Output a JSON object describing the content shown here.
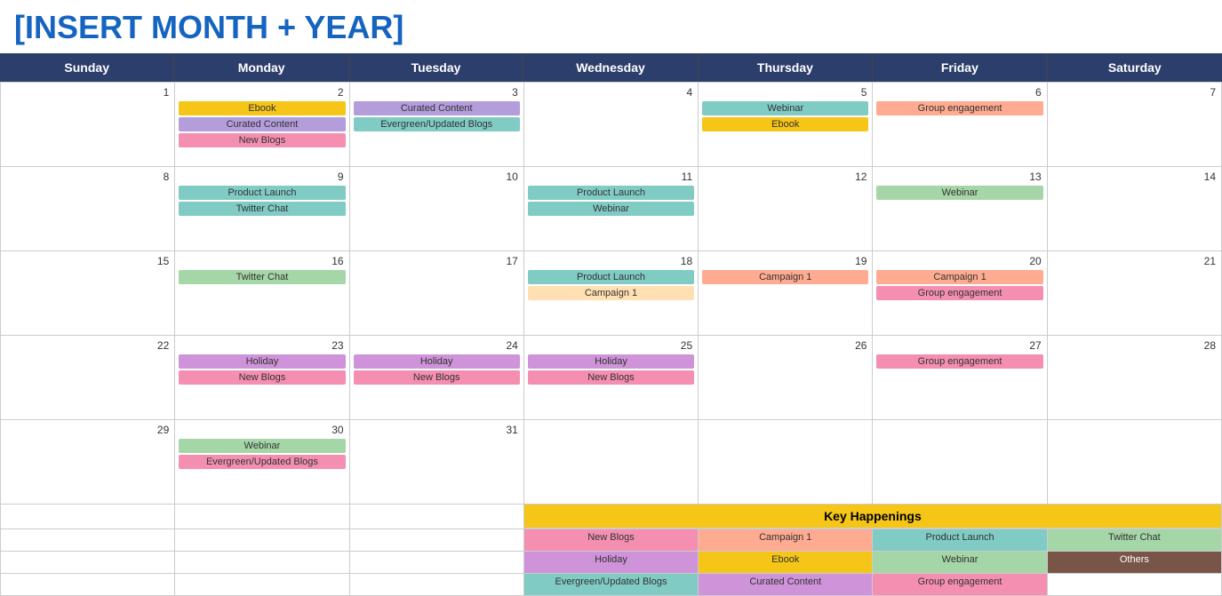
{
  "title": "[INSERT MONTH + YEAR]",
  "days": [
    "Sunday",
    "Monday",
    "Tuesday",
    "Wednesday",
    "Thursday",
    "Friday",
    "Saturday"
  ],
  "weeks": [
    {
      "cells": [
        {
          "date": "1",
          "events": []
        },
        {
          "date": "2",
          "events": [
            {
              "label": "Ebook",
              "color": "ev-yellow"
            },
            {
              "label": "Curated Content",
              "color": "ev-purple"
            },
            {
              "label": "New Blogs",
              "color": "ev-pink"
            }
          ]
        },
        {
          "date": "3",
          "events": [
            {
              "label": "Curated Content",
              "color": "ev-purple"
            },
            {
              "label": "Evergreen/Updated Blogs",
              "color": "ev-teal"
            }
          ]
        },
        {
          "date": "4",
          "events": []
        },
        {
          "date": "5",
          "events": [
            {
              "label": "Webinar",
              "color": "ev-teal"
            },
            {
              "label": "Ebook",
              "color": "ev-yellow"
            }
          ]
        },
        {
          "date": "6",
          "events": [
            {
              "label": "Group engagement",
              "color": "ev-salmon"
            }
          ]
        },
        {
          "date": "7",
          "events": []
        }
      ]
    },
    {
      "cells": [
        {
          "date": "8",
          "events": []
        },
        {
          "date": "9",
          "events": [
            {
              "label": "Product Launch",
              "color": "ev-teal"
            },
            {
              "label": "Twitter Chat",
              "color": "ev-teal"
            }
          ]
        },
        {
          "date": "10",
          "events": []
        },
        {
          "date": "11",
          "events": [
            {
              "label": "Product Launch",
              "color": "ev-teal"
            },
            {
              "label": "Webinar",
              "color": "ev-teal"
            }
          ]
        },
        {
          "date": "12",
          "events": []
        },
        {
          "date": "13",
          "events": [
            {
              "label": "Webinar",
              "color": "ev-green"
            }
          ]
        },
        {
          "date": "14",
          "events": []
        }
      ]
    },
    {
      "cells": [
        {
          "date": "15",
          "events": []
        },
        {
          "date": "16",
          "events": [
            {
              "label": "Twitter Chat",
              "color": "ev-green"
            }
          ]
        },
        {
          "date": "17",
          "events": []
        },
        {
          "date": "18",
          "events": [
            {
              "label": "Product Launch",
              "color": "ev-teal"
            },
            {
              "label": "Campaign 1",
              "color": "ev-peach"
            }
          ]
        },
        {
          "date": "19",
          "events": [
            {
              "label": "Campaign 1",
              "color": "ev-salmon"
            }
          ]
        },
        {
          "date": "20",
          "events": [
            {
              "label": "Campaign 1",
              "color": "ev-salmon"
            },
            {
              "label": "Group engagement",
              "color": "ev-pink"
            }
          ]
        },
        {
          "date": "21",
          "events": []
        }
      ]
    },
    {
      "cells": [
        {
          "date": "22",
          "events": []
        },
        {
          "date": "23",
          "events": [
            {
              "label": "Holiday",
              "color": "ev-lavender"
            },
            {
              "label": "New Blogs",
              "color": "ev-pink"
            }
          ]
        },
        {
          "date": "24",
          "events": [
            {
              "label": "Holiday",
              "color": "ev-lavender"
            },
            {
              "label": "New Blogs",
              "color": "ev-pink"
            }
          ]
        },
        {
          "date": "25",
          "events": [
            {
              "label": "Holiday",
              "color": "ev-lavender"
            },
            {
              "label": "New Blogs",
              "color": "ev-pink"
            }
          ]
        },
        {
          "date": "26",
          "events": []
        },
        {
          "date": "27",
          "events": [
            {
              "label": "Group engagement",
              "color": "ev-pink"
            }
          ]
        },
        {
          "date": "28",
          "events": []
        }
      ]
    },
    {
      "cells": [
        {
          "date": "29",
          "events": []
        },
        {
          "date": "30",
          "events": [
            {
              "label": "Webinar",
              "color": "ev-green"
            },
            {
              "label": "Evergreen/Updated Blogs",
              "color": "ev-pink"
            }
          ]
        },
        {
          "date": "31",
          "events": []
        },
        {
          "date": "",
          "events": []
        },
        {
          "date": "",
          "events": []
        },
        {
          "date": "",
          "events": []
        },
        {
          "date": "",
          "events": []
        }
      ]
    }
  ],
  "key_happenings": {
    "label": "Key Happenings",
    "rows": [
      {
        "cells": [
          {
            "label": "",
            "color": ""
          },
          {
            "label": "",
            "color": ""
          },
          {
            "label": "",
            "color": ""
          },
          {
            "label": "New Blogs",
            "color": "ev-pink"
          },
          {
            "label": "Campaign 1",
            "color": "ev-salmon"
          },
          {
            "label": "Product Launch",
            "color": "ev-teal"
          },
          {
            "label": "Twitter Chat",
            "color": "ev-green"
          }
        ]
      },
      {
        "cells": [
          {
            "label": "",
            "color": ""
          },
          {
            "label": "",
            "color": ""
          },
          {
            "label": "",
            "color": ""
          },
          {
            "label": "Holiday",
            "color": "ev-lavender"
          },
          {
            "label": "Ebook",
            "color": "ev-yellow"
          },
          {
            "label": "Webinar",
            "color": "ev-green"
          },
          {
            "label": "Others",
            "color": "ev-brown"
          }
        ]
      },
      {
        "cells": [
          {
            "label": "",
            "color": ""
          },
          {
            "label": "",
            "color": ""
          },
          {
            "label": "",
            "color": ""
          },
          {
            "label": "Evergreen/Updated Blogs",
            "color": "ev-teal"
          },
          {
            "label": "Curated Content",
            "color": "ev-lavender"
          },
          {
            "label": "Group engagement",
            "color": "ev-pink"
          },
          {
            "label": "",
            "color": ""
          }
        ]
      }
    ]
  }
}
